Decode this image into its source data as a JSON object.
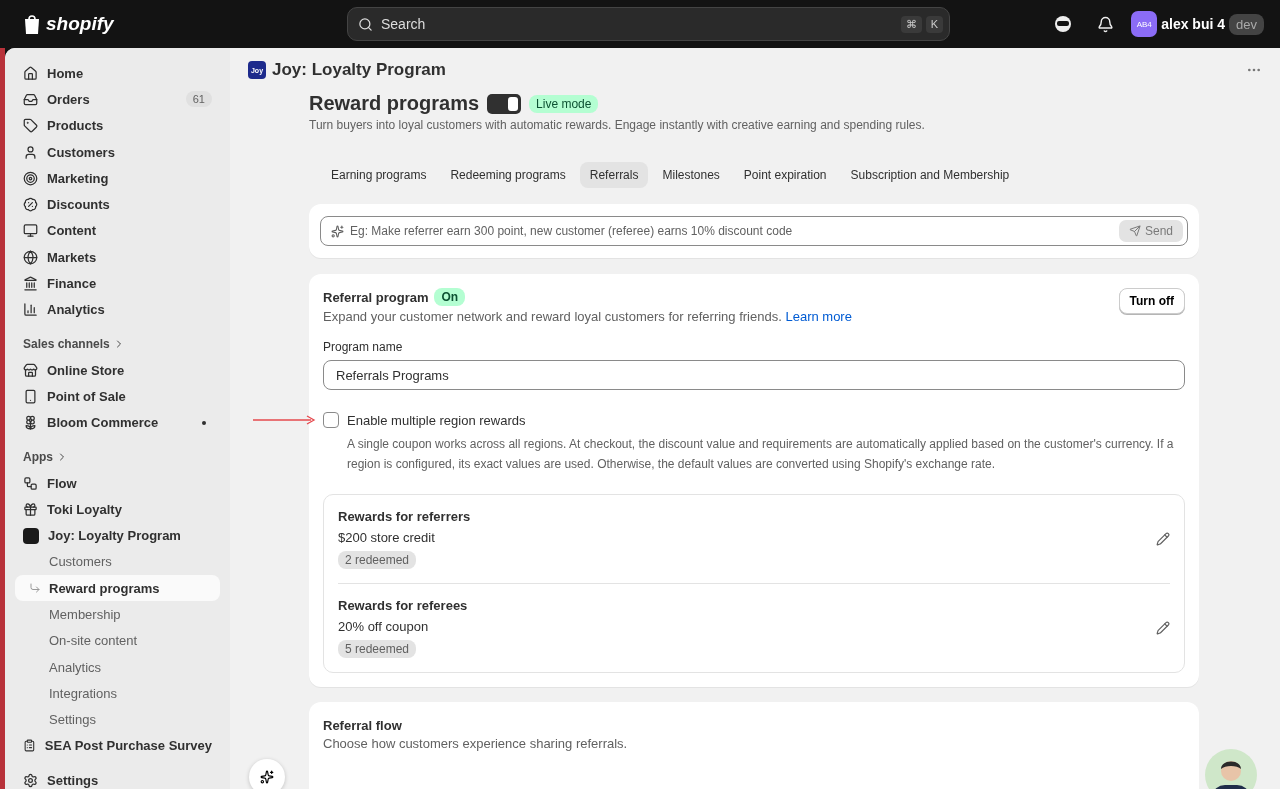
{
  "topbar": {
    "logo": "shopify",
    "search": {
      "placeholder": "Search"
    },
    "shortcut": [
      "⌘",
      "K"
    ],
    "user": {
      "initials": "AB4",
      "name": "alex bui 4",
      "badge": "dev"
    }
  },
  "sidebar": {
    "main": [
      {
        "label": "Home",
        "selected": false
      },
      {
        "label": "Orders",
        "count": "61",
        "selected": false
      },
      {
        "label": "Products",
        "selected": false
      },
      {
        "label": "Customers",
        "selected": false
      },
      {
        "label": "Marketing",
        "selected": false
      },
      {
        "label": "Discounts",
        "selected": false
      },
      {
        "label": "Content",
        "selected": false
      },
      {
        "label": "Markets",
        "selected": false
      },
      {
        "label": "Finance",
        "selected": false
      },
      {
        "label": "Analytics",
        "selected": false
      }
    ],
    "sales_channels": {
      "heading": "Sales channels",
      "items": [
        {
          "label": "Online Store",
          "dot": false
        },
        {
          "label": "Point of Sale",
          "dot": false
        },
        {
          "label": "Bloom Commerce",
          "dot": true
        }
      ]
    },
    "apps": {
      "heading": "Apps",
      "items": [
        {
          "label": "Flow"
        },
        {
          "label": "Toki Loyalty"
        },
        {
          "label": "Joy: Loyalty Program",
          "children": [
            {
              "label": "Customers",
              "selected": false
            },
            {
              "label": "Reward programs",
              "selected": true
            },
            {
              "label": "Membership",
              "selected": false
            },
            {
              "label": "On-site content",
              "selected": false
            },
            {
              "label": "Analytics",
              "selected": false
            },
            {
              "label": "Integrations",
              "selected": false
            },
            {
              "label": "Settings",
              "selected": false
            }
          ]
        },
        {
          "label": "SEA Post Purchase Survey"
        }
      ]
    },
    "bottom": [
      {
        "label": "Settings"
      }
    ]
  },
  "app_header": {
    "logo": "Joy",
    "title": "Joy: Loyalty Program"
  },
  "page": {
    "title": "Reward programs",
    "live_toggle": true,
    "live_badge": "Live mode",
    "subtitle": "Turn buyers into loyal customers with automatic rewards. Engage instantly with creative earning and spending rules.",
    "tabs": [
      {
        "label": "Earning programs",
        "selected": false
      },
      {
        "label": "Redeeming programs",
        "selected": false
      },
      {
        "label": "Referrals",
        "selected": true
      },
      {
        "label": "Milestones",
        "selected": false
      },
      {
        "label": "Point expiration",
        "selected": false
      },
      {
        "label": "Subscription and Membership",
        "selected": false
      }
    ],
    "prompt": {
      "placeholder": "Eg: Make referrer earn 300 point, new customer (referee) earns 10% discount code",
      "button": "Send",
      "disabled": true
    },
    "referral_program": {
      "title": "Referral program",
      "status": "On",
      "description": "Expand your customer network and reward loyal customers for referring friends.",
      "link": "Learn more",
      "button": "Turn off",
      "field_label": "Program name",
      "field_value": "Referrals Programs",
      "checkbox": {
        "label": "Enable multiple region rewards",
        "checked": false,
        "help": "A single coupon works across all regions. At checkout, the discount value and requirements are automatically applied based on the customer's currency. If a region is configured, its exact values are used. Otherwise, the default values are converted using Shopify's exchange rate."
      },
      "rewards": [
        {
          "title": "Rewards for referrers",
          "value": "$200 store credit",
          "badge": "2 redeemed"
        },
        {
          "title": "Rewards for referees",
          "value": "20% off coupon",
          "badge": "5 redeemed"
        }
      ]
    },
    "referral_flow": {
      "title": "Referral flow",
      "description": "Choose how customers experience sharing referrals."
    }
  }
}
